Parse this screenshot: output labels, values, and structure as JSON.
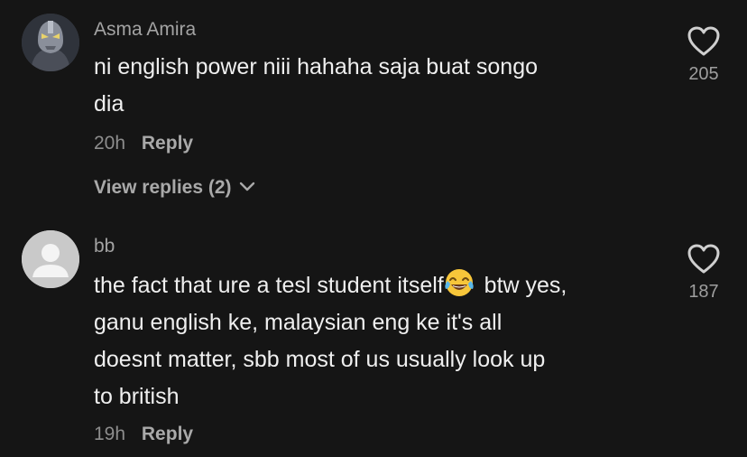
{
  "comments": [
    {
      "username": "Asma Amira",
      "lines": [
        "ni english power niii hahaha saja buat songo",
        "dia"
      ],
      "time": "20h",
      "reply_label": "Reply",
      "view_replies": "View replies (2)",
      "likes": "205",
      "avatar": "profile-photo"
    },
    {
      "username": "bb",
      "line1_before": "the fact that ure a tesl student itself",
      "emoji": "face-with-tears-of-joy",
      "line1_after": " btw yes,",
      "lines_rest": [
        "ganu english ke, malaysian eng ke it's all",
        "doesnt matter, sbb most of us usually look up",
        "to british"
      ],
      "time": "19h",
      "reply_label": "Reply",
      "likes": "187",
      "avatar": "default-avatar"
    }
  ],
  "colors": {
    "background": "#151515",
    "username": "#a3a3a3",
    "text": "#efefef",
    "muted": "#8d8d8d"
  }
}
